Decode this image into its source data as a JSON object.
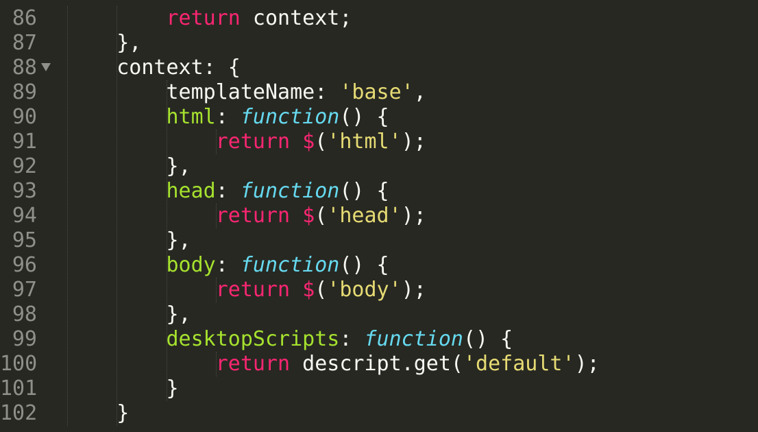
{
  "editor": {
    "theme_colors": {
      "background": "#272822",
      "line_number": "#8f908a",
      "keyword": "#f92672",
      "function": "#66d9ef",
      "string": "#e6db74",
      "property": "#a6e22e",
      "plain": "#f8f8f2"
    },
    "lines": [
      {
        "num": "86",
        "fold": false,
        "indent": "        ",
        "tokens": [
          [
            "kw",
            "return"
          ],
          [
            "pl",
            " context;"
          ]
        ]
      },
      {
        "num": "87",
        "fold": false,
        "indent": "    ",
        "tokens": [
          [
            "pl",
            "},"
          ]
        ]
      },
      {
        "num": "88",
        "fold": true,
        "indent": "    ",
        "tokens": [
          [
            "pl",
            "context: {"
          ]
        ]
      },
      {
        "num": "89",
        "fold": false,
        "indent": "        ",
        "tokens": [
          [
            "pl",
            "templateName: "
          ],
          [
            "str",
            "'base'"
          ],
          [
            "pl",
            ","
          ]
        ]
      },
      {
        "num": "90",
        "fold": false,
        "indent": "        ",
        "tokens": [
          [
            "prop",
            "html"
          ],
          [
            "pl",
            ": "
          ],
          [
            "fn",
            "function"
          ],
          [
            "pl",
            "() {"
          ]
        ]
      },
      {
        "num": "91",
        "fold": false,
        "indent": "            ",
        "tokens": [
          [
            "kw",
            "return"
          ],
          [
            "pl",
            " "
          ],
          [
            "kw",
            "$"
          ],
          [
            "pl",
            "("
          ],
          [
            "str",
            "'html'"
          ],
          [
            "pl",
            ");"
          ]
        ]
      },
      {
        "num": "92",
        "fold": false,
        "indent": "        ",
        "tokens": [
          [
            "pl",
            "},"
          ]
        ]
      },
      {
        "num": "93",
        "fold": false,
        "indent": "        ",
        "tokens": [
          [
            "prop",
            "head"
          ],
          [
            "pl",
            ": "
          ],
          [
            "fn",
            "function"
          ],
          [
            "pl",
            "() {"
          ]
        ]
      },
      {
        "num": "94",
        "fold": false,
        "indent": "            ",
        "tokens": [
          [
            "kw",
            "return"
          ],
          [
            "pl",
            " "
          ],
          [
            "kw",
            "$"
          ],
          [
            "pl",
            "("
          ],
          [
            "str",
            "'head'"
          ],
          [
            "pl",
            ");"
          ]
        ]
      },
      {
        "num": "95",
        "fold": false,
        "indent": "        ",
        "tokens": [
          [
            "pl",
            "},"
          ]
        ]
      },
      {
        "num": "96",
        "fold": false,
        "indent": "        ",
        "tokens": [
          [
            "prop",
            "body"
          ],
          [
            "pl",
            ": "
          ],
          [
            "fn",
            "function"
          ],
          [
            "pl",
            "() {"
          ]
        ]
      },
      {
        "num": "97",
        "fold": false,
        "indent": "            ",
        "tokens": [
          [
            "kw",
            "return"
          ],
          [
            "pl",
            " "
          ],
          [
            "kw",
            "$"
          ],
          [
            "pl",
            "("
          ],
          [
            "str",
            "'body'"
          ],
          [
            "pl",
            ");"
          ]
        ]
      },
      {
        "num": "98",
        "fold": false,
        "indent": "        ",
        "tokens": [
          [
            "pl",
            "},"
          ]
        ]
      },
      {
        "num": "99",
        "fold": false,
        "indent": "        ",
        "tokens": [
          [
            "prop",
            "desktopScripts"
          ],
          [
            "pl",
            ": "
          ],
          [
            "fn",
            "function"
          ],
          [
            "pl",
            "() {"
          ]
        ]
      },
      {
        "num": "100",
        "fold": false,
        "indent": "            ",
        "tokens": [
          [
            "kw",
            "return"
          ],
          [
            "pl",
            " descript.get("
          ],
          [
            "str",
            "'default'"
          ],
          [
            "pl",
            ");"
          ]
        ]
      },
      {
        "num": "101",
        "fold": false,
        "indent": "        ",
        "tokens": [
          [
            "pl",
            "}"
          ]
        ]
      },
      {
        "num": "102",
        "fold": false,
        "indent": "    ",
        "tokens": [
          [
            "pl",
            "}"
          ]
        ]
      }
    ]
  }
}
